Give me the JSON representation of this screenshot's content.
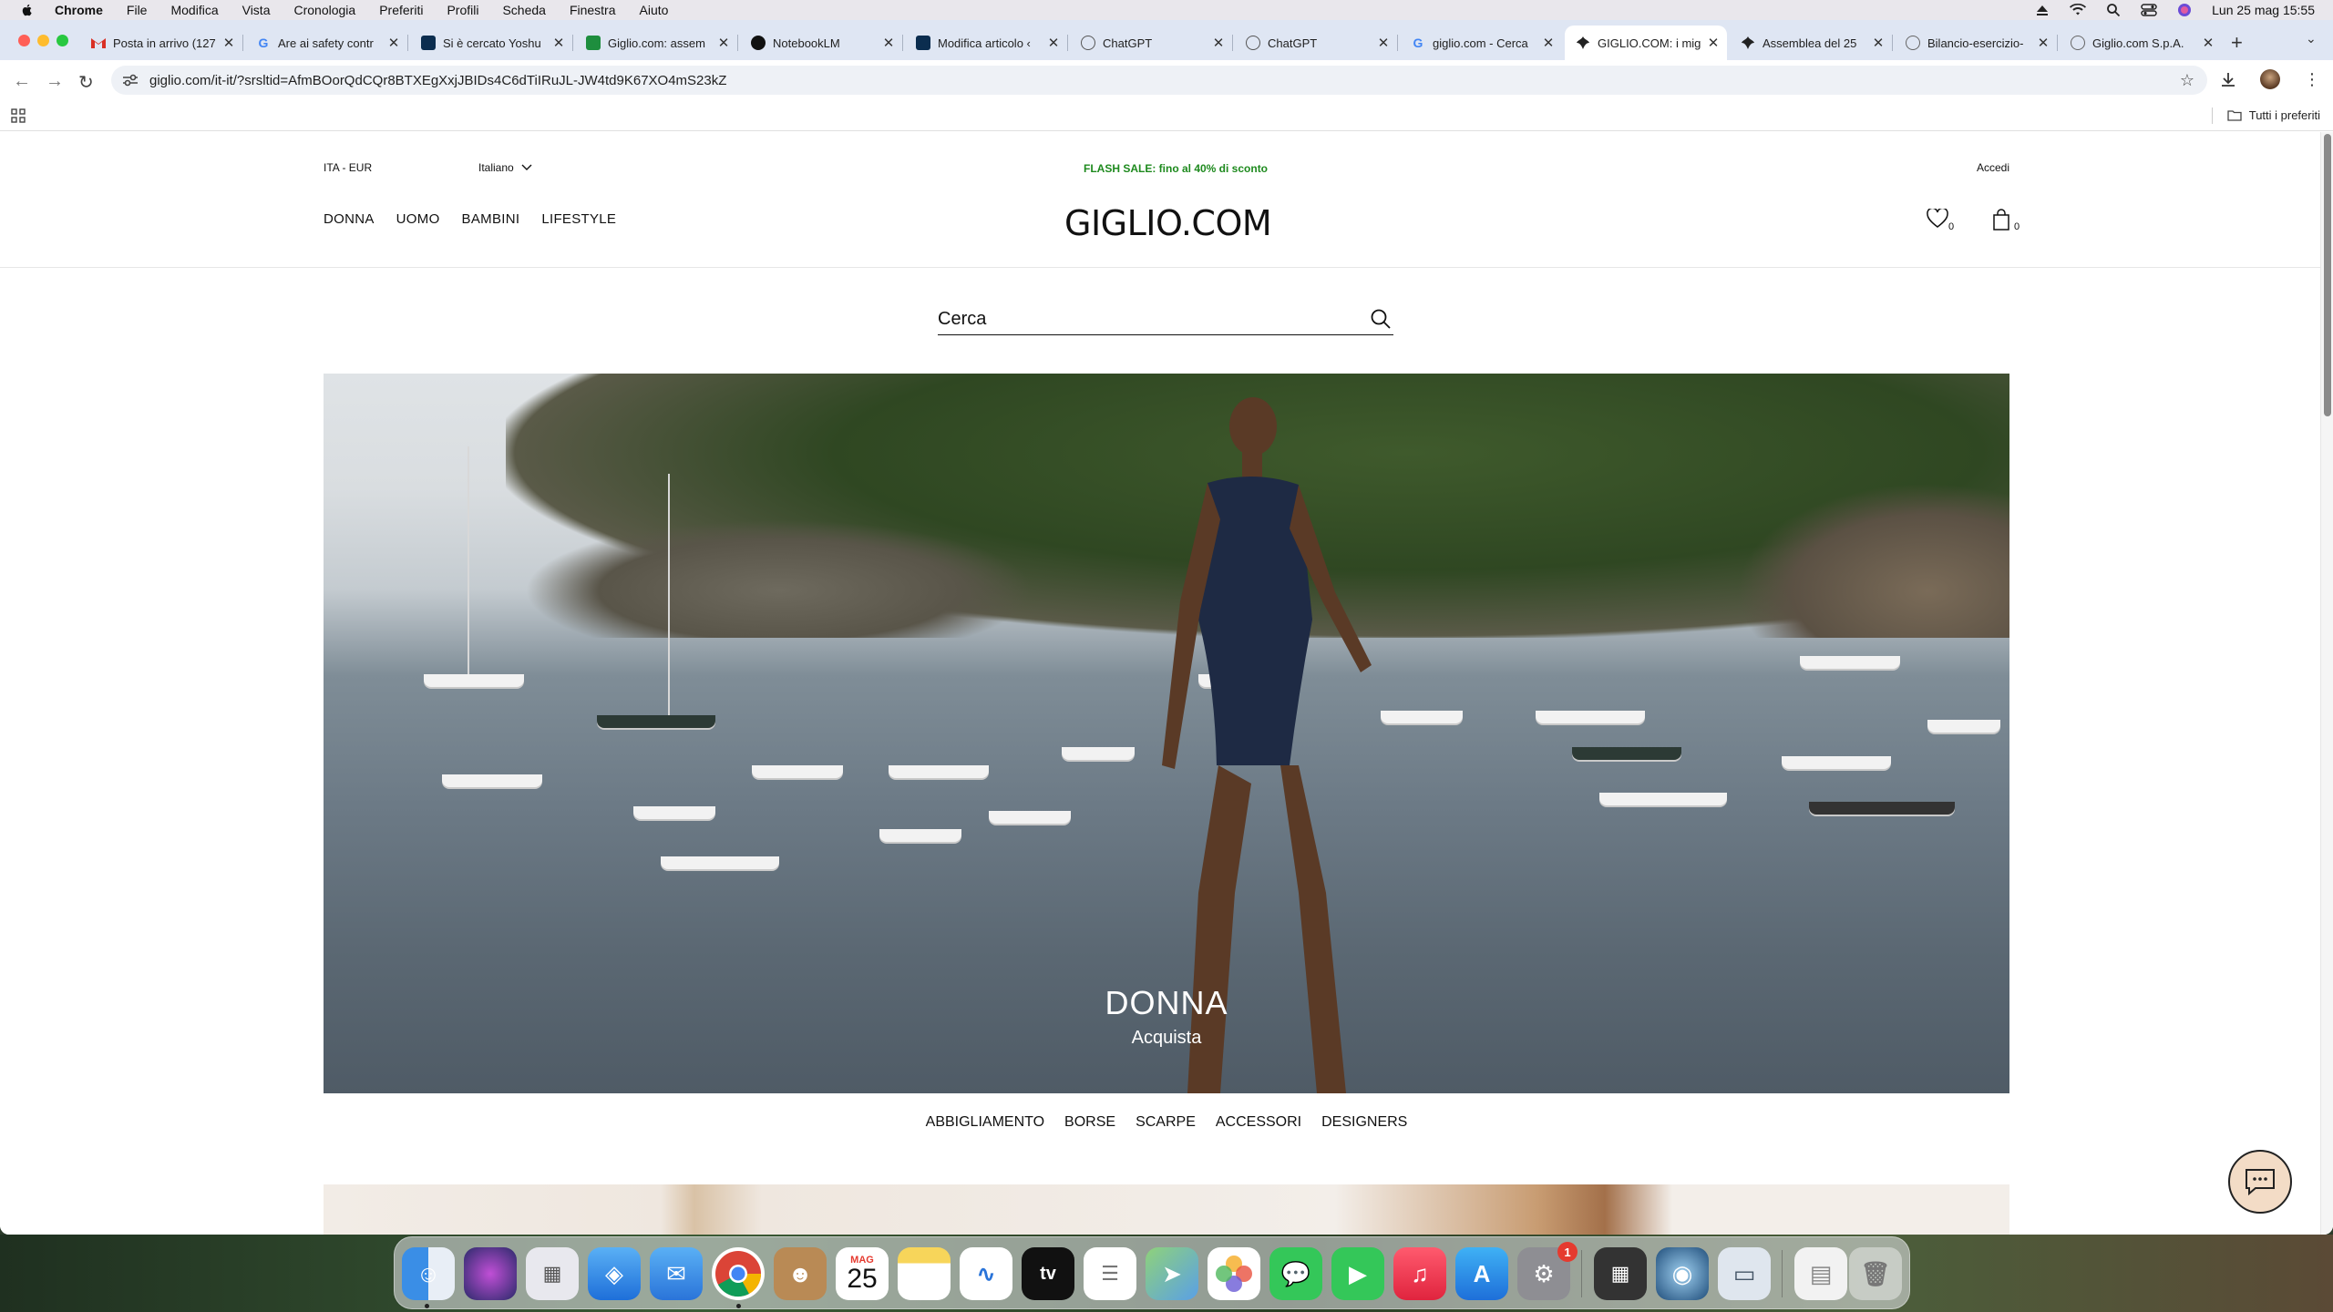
{
  "menubar": {
    "app": "Chrome",
    "items": [
      "File",
      "Modifica",
      "Vista",
      "Cronologia",
      "Preferiti",
      "Profili",
      "Scheda",
      "Finestra",
      "Aiuto"
    ],
    "datetime": "Lun 25 mag  15:55"
  },
  "tabs": [
    {
      "title": "Posta in arrivo (127",
      "icon": "gmail-icon",
      "color": "#d93025"
    },
    {
      "title": "Are ai safety contr",
      "icon": "google-icon",
      "color": "#4285f4"
    },
    {
      "title": "Si è cercato Yoshu",
      "icon": "site-icon",
      "color": "#0b2d4f"
    },
    {
      "title": "Giglio.com: assem",
      "icon": "sheets-icon",
      "color": "#1e8e3e"
    },
    {
      "title": "NotebookLM",
      "icon": "notebooklm-icon",
      "color": "#111111"
    },
    {
      "title": "Modifica articolo ‹",
      "icon": "site-icon",
      "color": "#0b2d4f"
    },
    {
      "title": "ChatGPT",
      "icon": "chatgpt-icon",
      "color": "#555555"
    },
    {
      "title": "ChatGPT",
      "icon": "chatgpt-icon",
      "color": "#555555"
    },
    {
      "title": "giglio.com - Cerca",
      "icon": "google-icon",
      "color": "#4285f4"
    },
    {
      "title": "GIGLIO.COM: i mig",
      "icon": "giglio-icon",
      "color": "#222222",
      "active": true
    },
    {
      "title": "Assemblea del 25 ",
      "icon": "giglio-icon",
      "color": "#222222"
    },
    {
      "title": "Bilancio-esercizio-",
      "icon": "link-icon",
      "color": "#666666"
    },
    {
      "title": "Giglio.com S.p.A. ",
      "icon": "link-icon",
      "color": "#666666"
    }
  ],
  "toolbar": {
    "url": "giglio.com/it-it/?srsltid=AfmBOorQdCQr8BTXEgXxjJBIDs4C6dTiIRuJL-JW4td9K67XO4mS23kZ"
  },
  "bookmarks": {
    "all_label": "Tutti i preferiti"
  },
  "site": {
    "locale": "ITA - EUR",
    "language": "Italiano",
    "promo": "FLASH SALE: fino al 40% di sconto",
    "login": "Accedi",
    "nav": [
      "DONNA",
      "UOMO",
      "BAMBINI",
      "LIFESTYLE"
    ],
    "logo": "GIGLIO.COM",
    "wishlist_count": "0",
    "cart_count": "0",
    "search_placeholder": "Cerca",
    "hero": {
      "title": "DONNA",
      "cta": "Acquista"
    },
    "subnav": [
      "ABBIGLIAMENTO",
      "BORSE",
      "SCARPE",
      "ACCESSORI",
      "DESIGNERS"
    ],
    "accent_promo_color": "#1e8a1e"
  },
  "dock": {
    "calendar_month": "MAG",
    "calendar_day": "25",
    "settings_badge": "1",
    "apps": [
      "finder",
      "siri",
      "launchpad",
      "safari",
      "mail",
      "chrome",
      "contacts",
      "calendar",
      "notes",
      "freeform",
      "apple-tv",
      "reminders",
      "maps",
      "photos",
      "messages",
      "facetime",
      "music",
      "app-store",
      "system-settings",
      "calculator",
      "quicktime",
      "preview",
      "documents",
      "trash"
    ]
  }
}
